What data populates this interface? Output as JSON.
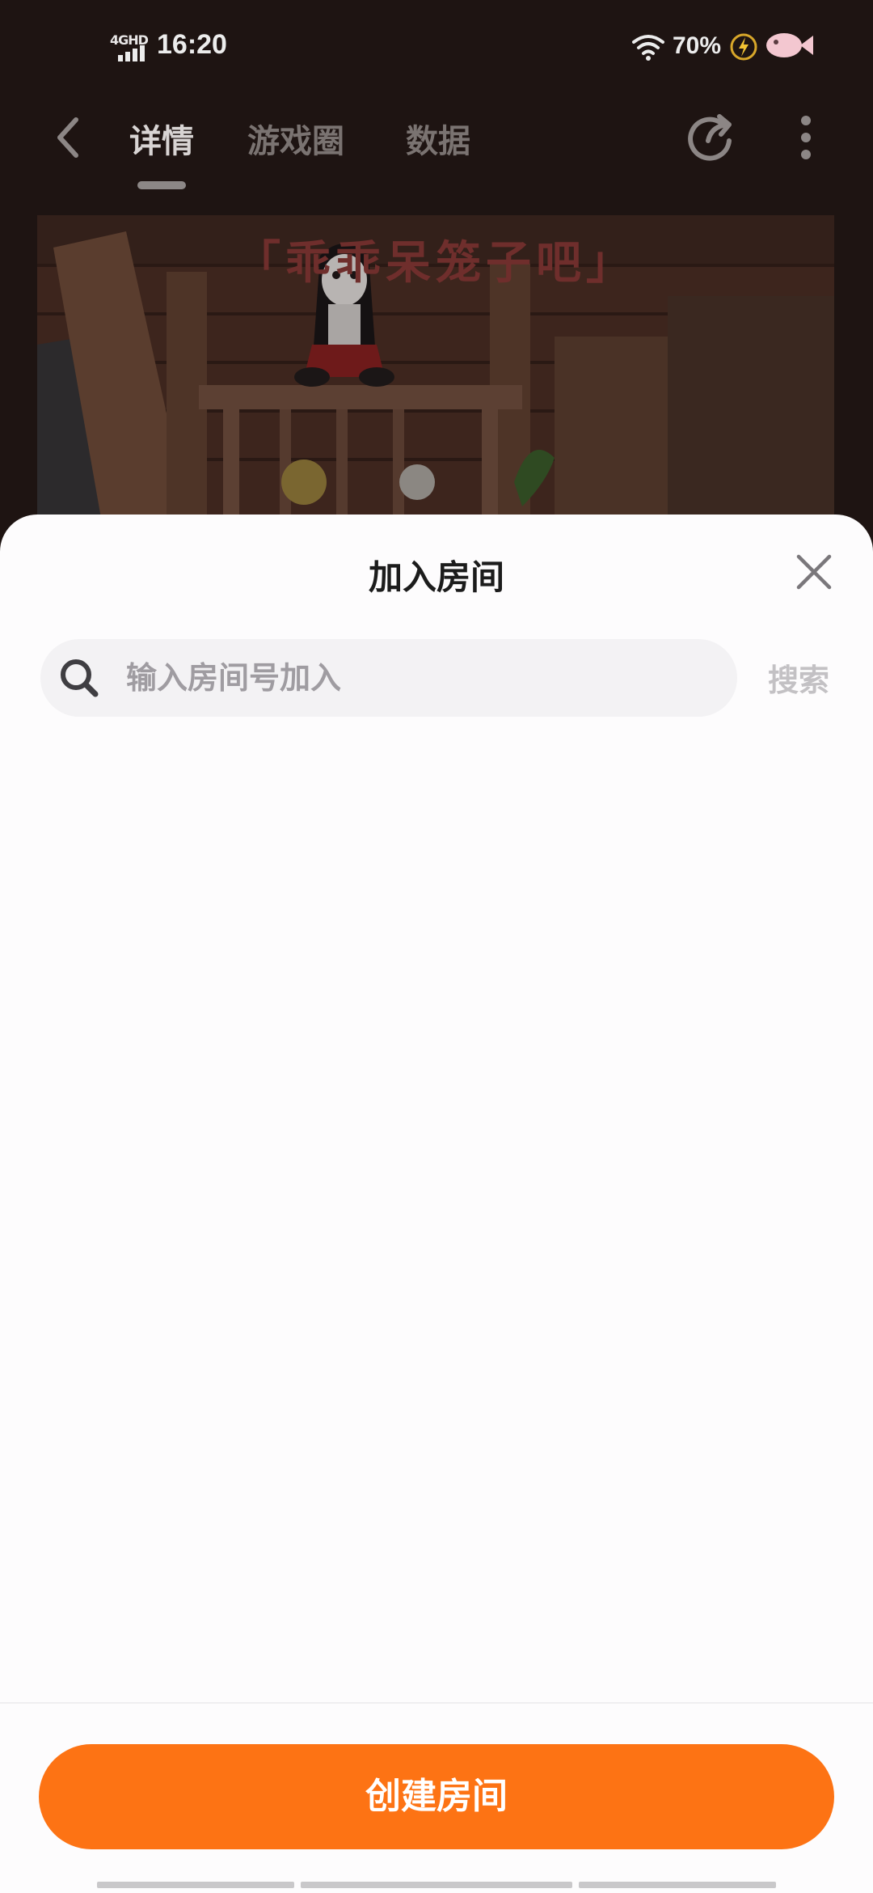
{
  "status_bar": {
    "network": "4GHD",
    "time": "16:20",
    "battery": "70%"
  },
  "nav": {
    "tabs": [
      {
        "label": "详情",
        "active": true
      },
      {
        "label": "游戏圈",
        "active": false
      },
      {
        "label": "数据",
        "active": false
      }
    ]
  },
  "banner": {
    "title": "「乖乖呆笼子吧」"
  },
  "sheet": {
    "title": "加入房间",
    "search_placeholder": "输入房间号加入",
    "search_value": "",
    "search_button": "搜索",
    "create_button": "创建房间"
  },
  "colors": {
    "accent": "#fd7314",
    "sheet_bg": "#fdfcfd",
    "search_bg": "#f3f2f4"
  },
  "icons": [
    "back-arrow-icon",
    "share-icon",
    "more-vertical-icon",
    "close-icon",
    "search-icon",
    "wifi-icon",
    "charging-icon",
    "fish-icon"
  ]
}
